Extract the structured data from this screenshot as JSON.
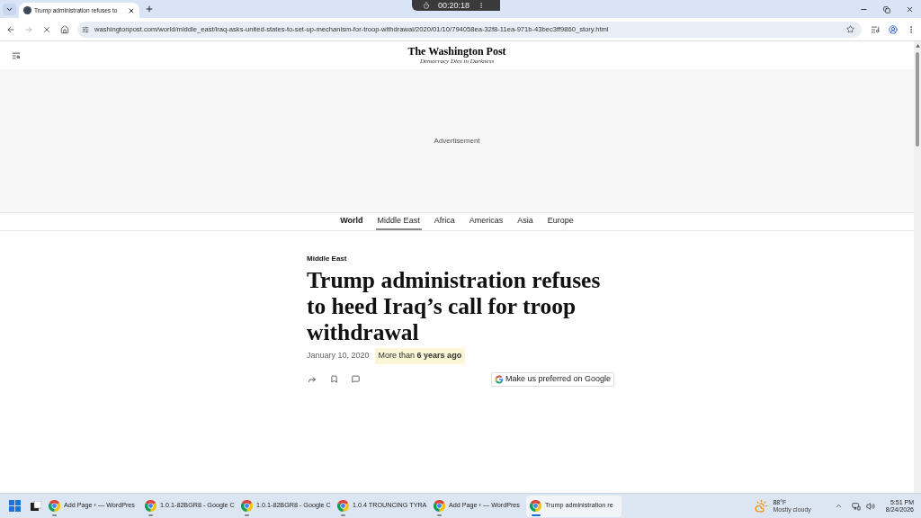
{
  "browser": {
    "tabs": [
      {
        "title": "Trump administration refuses to",
        "selected": true
      }
    ],
    "recorder_time": "00:20:18",
    "url": "washingtonpost.com/world/middle_east/iraq-asks-united-states-to-set-up-mechanism-for-troop-withdrawal/2020/01/10/794058ea-32f8-11ea-971b-43bec3ff9860_story.html"
  },
  "site_header": {
    "logo": "The Washington Post",
    "tagline": "Democracy Dies in Darkness"
  },
  "advertisement": {
    "label": "Advertisement"
  },
  "section_nav": [
    {
      "label": "World",
      "kind": "section",
      "selected": false
    },
    {
      "label": "Middle East",
      "kind": "subsection",
      "selected": true
    },
    {
      "label": "Africa",
      "kind": "subsection",
      "selected": false
    },
    {
      "label": "Americas",
      "kind": "subsection",
      "selected": false
    },
    {
      "label": "Asia",
      "kind": "subsection",
      "selected": false
    },
    {
      "label": "Europe",
      "kind": "subsection",
      "selected": false
    }
  ],
  "article": {
    "kicker": "Middle East",
    "headline": "Trump administration refuses to heed Iraq’s call for troop withdrawal",
    "date": "January 10, 2020",
    "age": "More than **6 years ago**",
    "google_button": "Make us preferred on Google"
  },
  "taskbar": {
    "apps": [
      {
        "label": "Add Page ‹ — WordPres",
        "selected": false
      },
      {
        "label": "1.0.1-82BGR8 - Google C",
        "selected": false
      },
      {
        "label": "1.0.1-82BGR8 - Google C",
        "selected": false
      },
      {
        "label": "1.0.4 TROUNCING TYRA",
        "selected": false
      },
      {
        "label": "Add Page ‹ — WordPres",
        "selected": false
      },
      {
        "label": "Trump administration re",
        "selected": true
      }
    ],
    "weather": {
      "temperature": "88°F",
      "condition": "Mostly cloudy"
    },
    "clock": {
      "time": "5:51 PM",
      "date": "8/24/2026"
    }
  }
}
